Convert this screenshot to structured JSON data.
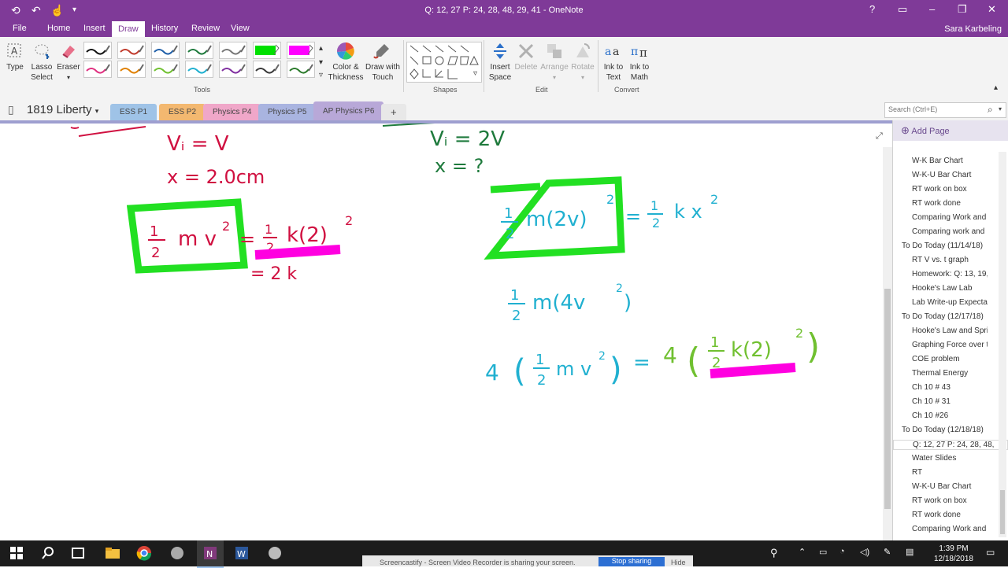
{
  "window": {
    "title": "Q: 12, 27 P: 24, 28, 48, 29, 41 - OneNote",
    "user": "Sara Karbeling",
    "help": "?"
  },
  "ribbon_tabs": [
    "File",
    "Home",
    "Insert",
    "Draw",
    "History",
    "Review",
    "View"
  ],
  "ribbon": {
    "type": "Type",
    "lasso_select": [
      "Lasso",
      "Select"
    ],
    "eraser": "Eraser",
    "tools_group": "Tools",
    "color_thickness": [
      "Color &",
      "Thickness"
    ],
    "draw_with_touch": [
      "Draw with",
      "Touch"
    ],
    "shapes_group": "Shapes",
    "insert_space": [
      "Insert",
      "Space"
    ],
    "delete": "Delete",
    "arrange": "Arrange",
    "rotate": "Rotate",
    "edit_group": "Edit",
    "ink_to_text": [
      "Ink to",
      "Text"
    ],
    "ink_to_math": [
      "Ink to",
      "Math"
    ],
    "convert_group": "Convert",
    "pen_colors": [
      "#111111",
      "#c0392b",
      "#1f5fa8",
      "#1e7a3c",
      "#777777",
      "#00e000",
      "#ff00ff",
      "#e03080",
      "#e08000",
      "#70c030",
      "#20b0d0",
      "#8030a0",
      "#3a3a3a",
      "#2a7a2a"
    ]
  },
  "notebook": {
    "name": "1819 Liberty",
    "sections": [
      {
        "label": "ESS P1",
        "color": "#9fc3e7"
      },
      {
        "label": "ESS P2",
        "color": "#f3b870"
      },
      {
        "label": "Physics P4",
        "color": "#f0a7c9"
      },
      {
        "label": "Physics P5",
        "color": "#a9b4e0"
      },
      {
        "label": "AP Physics P6",
        "color": "#b8a8d8"
      }
    ],
    "add_section": "+"
  },
  "search": {
    "placeholder": "Search (Ctrl+E)"
  },
  "pages": {
    "add_page": "Add Page",
    "items": [
      {
        "label": "W-K Bar Chart",
        "indent": 1
      },
      {
        "label": "W-K-U Bar Chart",
        "indent": 1
      },
      {
        "label": "RT work on box",
        "indent": 1
      },
      {
        "label": "RT work done",
        "indent": 1
      },
      {
        "label": "Comparing Work and",
        "indent": 1
      },
      {
        "label": "Comparing work and",
        "indent": 1
      },
      {
        "label": "To Do Today (11/14/18)",
        "indent": 0
      },
      {
        "label": "RT V vs. t graph",
        "indent": 1
      },
      {
        "label": "Homework: Q: 13, 19,",
        "indent": 1
      },
      {
        "label": "Hooke's Law Lab",
        "indent": 1
      },
      {
        "label": "Lab Write-up Expecta",
        "indent": 1
      },
      {
        "label": "To Do Today (12/17/18)",
        "indent": 0
      },
      {
        "label": "Hooke's Law and Spri",
        "indent": 1
      },
      {
        "label": "Graphing Force over t",
        "indent": 1
      },
      {
        "label": "COE problem",
        "indent": 1
      },
      {
        "label": "Thermal Energy",
        "indent": 1
      },
      {
        "label": "Ch 10 # 43",
        "indent": 1
      },
      {
        "label": "Ch 10 # 31",
        "indent": 1
      },
      {
        "label": "Ch 10 #26",
        "indent": 1
      },
      {
        "label": "To Do Today (12/18/18)",
        "indent": 0
      },
      {
        "label": "Q: 12, 27 P: 24, 28, 48,",
        "indent": 1,
        "selected": true
      },
      {
        "label": "Water Slides",
        "indent": 1
      },
      {
        "label": "RT",
        "indent": 1
      },
      {
        "label": "W-K-U Bar Chart",
        "indent": 1
      },
      {
        "label": "RT work on box",
        "indent": 1
      },
      {
        "label": "RT work done",
        "indent": 1
      },
      {
        "label": "Comparing Work and",
        "indent": 1
      }
    ]
  },
  "taskbar": {
    "time": "1:39 PM",
    "date": "12/18/2018"
  },
  "notification": {
    "text": "Screencastify - Screen Video Recorder is sharing your screen.",
    "stop": "Stop sharing",
    "hide": "Hide"
  },
  "ink": {
    "left_line1": "Vᵢ = V",
    "left_line2": "x = 2.0cm",
    "right_line1": "Vᵢ = 2V",
    "right_line2": "x = ?"
  }
}
